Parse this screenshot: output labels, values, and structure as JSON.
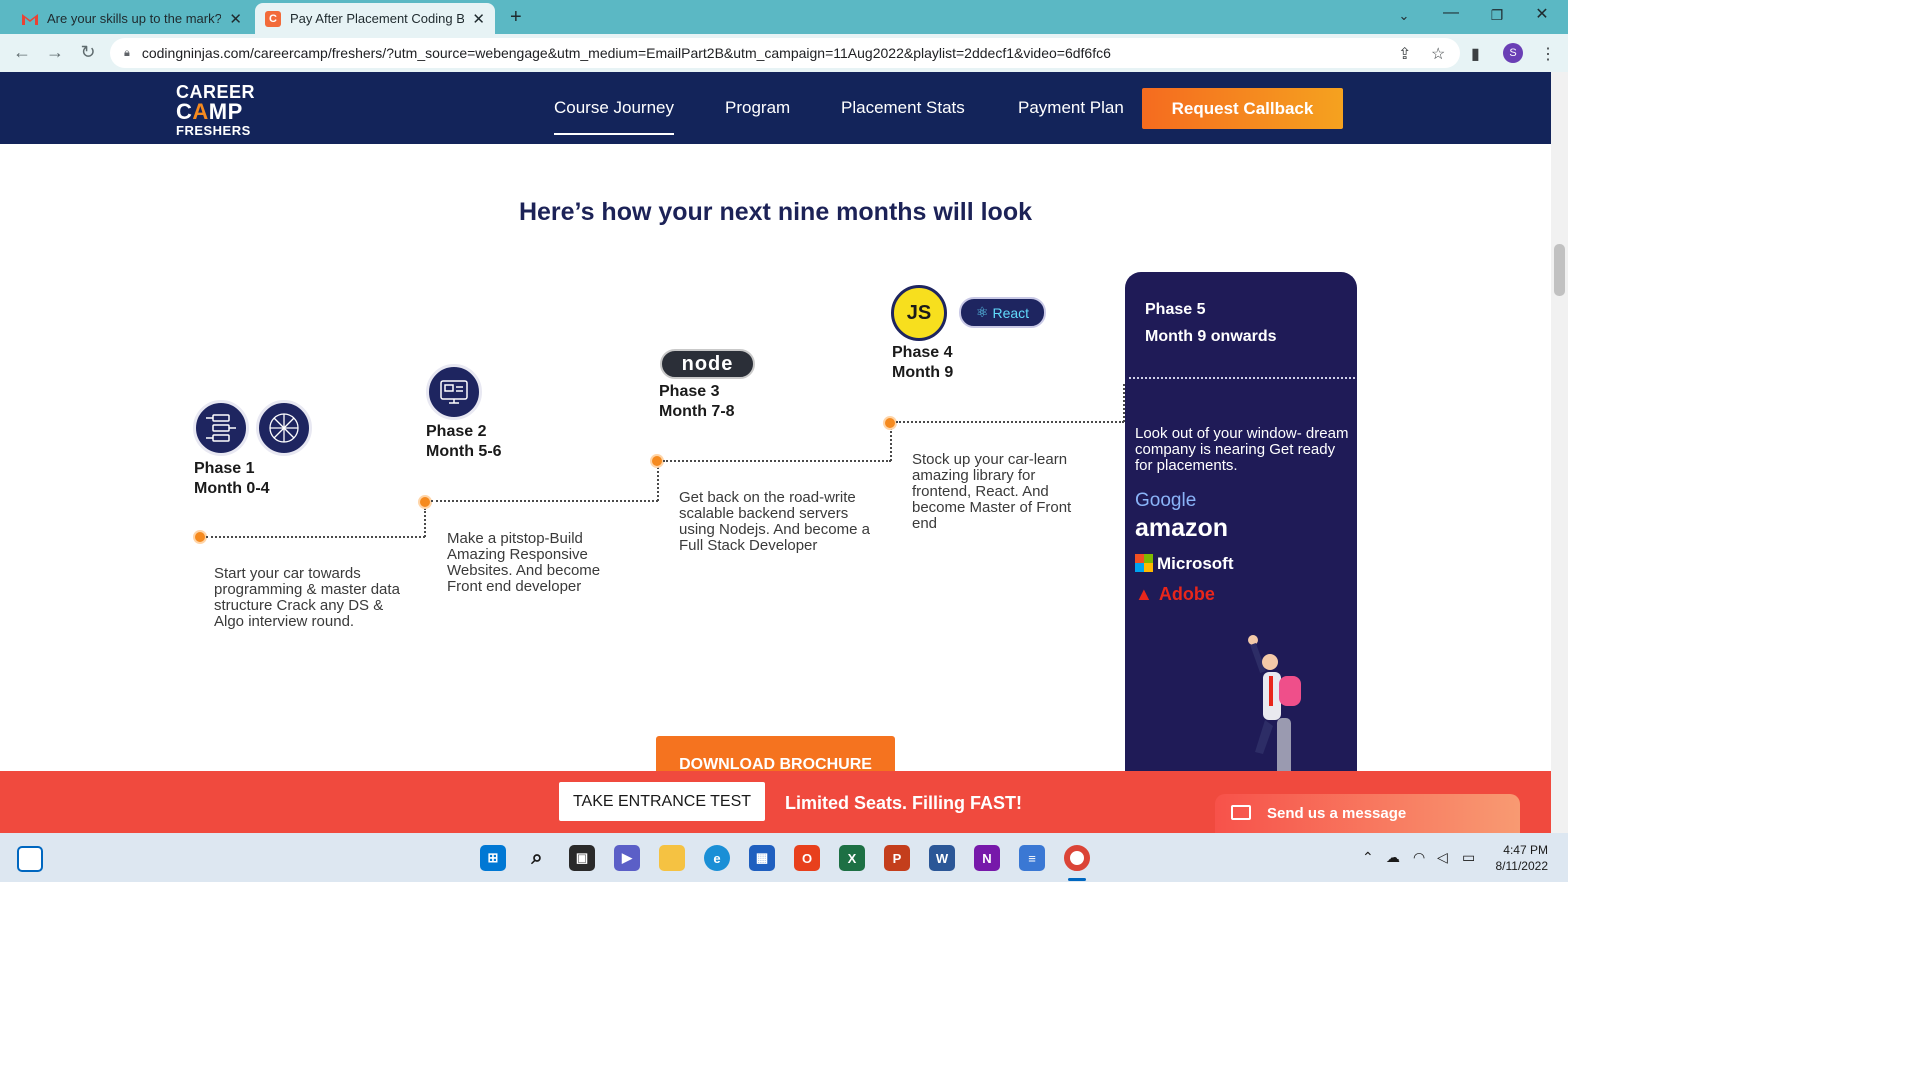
{
  "browser": {
    "tabs": [
      {
        "title": "Are your skills up to the mark? - ",
        "favicon": "gmail-icon"
      },
      {
        "title": "Pay After Placement Coding Boot",
        "favicon": "codingninjas-icon"
      }
    ],
    "new_tab": "+",
    "url": "codingninjas.com/careercamp/freshers/?utm_source=webengage&utm_medium=EmailPart2B&utm_campaign=11Aug2022&playlist=2ddecf1&video=6df6fc6",
    "profile_initial": "S"
  },
  "header": {
    "logo": {
      "line1": "CAREER",
      "line2a": "C",
      "line2b": "A",
      "line2c": "MP",
      "line3": "FRESHERS"
    },
    "nav": [
      "Course Journey",
      "Program",
      "Placement Stats",
      "Payment Plan"
    ],
    "cta": "Request Callback"
  },
  "main": {
    "heading": "Here’s how your next nine months will look",
    "phases": [
      {
        "phase": "Phase 1",
        "months": "Month 0-4",
        "desc": "Start your car towards programming & master data structure Crack any DS & Algo interview round."
      },
      {
        "phase": "Phase 2",
        "months": "Month 5-6",
        "desc": "Make a pitstop-Build Amazing Responsive Websites. And become Front end developer"
      },
      {
        "phase": "Phase 3",
        "months": "Month 7-8",
        "desc": "Get back on the road-write scalable backend servers using Nodejs. And become a Full Stack Developer"
      },
      {
        "phase": "Phase 4",
        "months": "Month 9",
        "desc": "Stock up your car-learn amazing library for frontend, React. And become Master of Front end"
      }
    ],
    "phase5": {
      "phase": "Phase 5",
      "months": "Month 9 onwards",
      "desc": "Look out of your window- dream company is nearing Get ready for placements.",
      "companies": [
        "Google",
        "amazon",
        "Microsoft",
        "Adobe"
      ]
    },
    "badges": {
      "node": "node",
      "js": "JS",
      "react": "React"
    },
    "download": "DOWNLOAD BROCHURE"
  },
  "bottom_bar": {
    "test": "TAKE ENTRANCE TEST",
    "limited": "Limited Seats. Filling FAST!",
    "message": "Send us a message"
  },
  "taskbar": {
    "time": "4:47 PM",
    "date": "8/11/2022"
  },
  "colors": {
    "header_bg": "#13245a",
    "accent_orange": "#f58a1f",
    "card_bg": "#1f1b57",
    "bottom_bar": "#f04a3e",
    "tab_bar": "#5bb8c4"
  }
}
